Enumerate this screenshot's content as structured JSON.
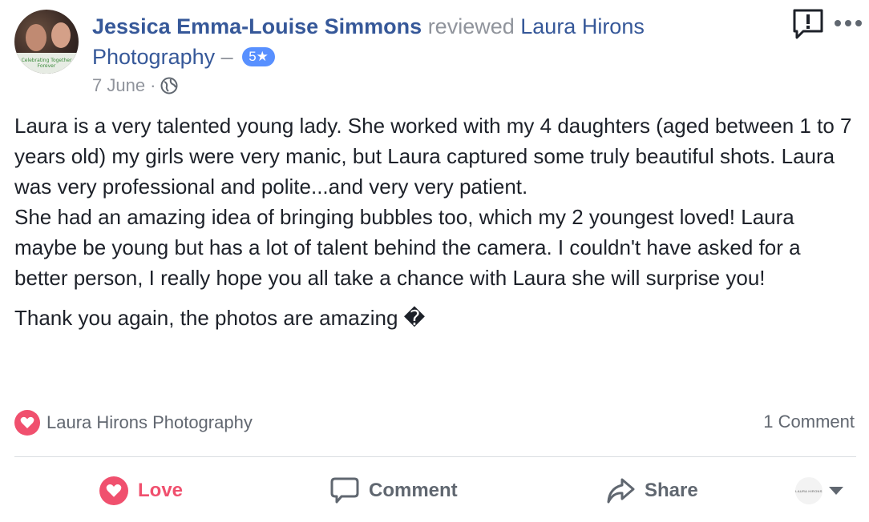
{
  "review": {
    "reviewer_name": "Jessica Emma-Louise Simmons",
    "action_text": "reviewed",
    "page_name_line1": "Laura Hirons",
    "page_name_line2": "Photography",
    "dash": "–",
    "rating_label": "5★",
    "date": "7 June",
    "separator": "·",
    "avatar_caption": "Celebrating Together Forever"
  },
  "content": {
    "paragraph1": "Laura is a very talented young lady. She worked with my 4 daughters (aged between 1 to 7 years old) my girls were very manic, but Laura captured some truly beautiful shots. Laura was very professional and polite...and very very patient.",
    "paragraph2": "She had an amazing idea of bringing bubbles too, which my 2 youngest loved! Laura maybe be young but has a lot of talent behind the camera. I couldn't have asked for a better person, I really hope you all take a chance with Laura she will surprise you!",
    "paragraph3": "Thank you again, the photos are amazing �"
  },
  "reactions": {
    "reactor": "Laura Hirons Photography",
    "comment_count": "1 Comment"
  },
  "actions": {
    "love_label": "Love",
    "comment_label": "Comment",
    "share_label": "Share",
    "page_avatar_text": "LAURA HIRONS"
  },
  "colors": {
    "link": "#365899",
    "love": "#f0506e",
    "badge": "#5890ff",
    "muted": "#90949c"
  },
  "icons": {
    "report": "report-icon",
    "more": "more-icon",
    "globe": "globe-icon",
    "love": "heart-icon",
    "comment": "comment-icon",
    "share": "share-icon",
    "caret": "caret-down-icon"
  }
}
